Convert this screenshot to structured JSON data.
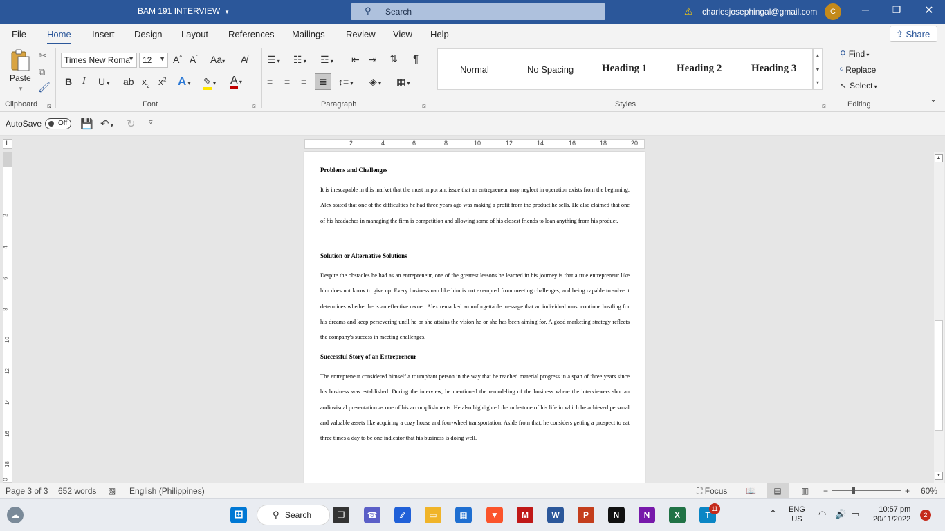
{
  "titlebar": {
    "doc_title": "BAM 191 INTERVIEW",
    "search": "Search",
    "email": "charlesjosephingal@gmail.com",
    "avatar": "C"
  },
  "tabs": [
    "File",
    "Home",
    "Insert",
    "Design",
    "Layout",
    "References",
    "Mailings",
    "Review",
    "View",
    "Help"
  ],
  "share": "Share",
  "ribbon": {
    "paste": "Paste",
    "font_name": "Times New Roma",
    "font_size": "12",
    "groups": {
      "clipboard": "Clipboard",
      "font": "Font",
      "paragraph": "Paragraph",
      "styles": "Styles",
      "editing": "Editing"
    },
    "styles": [
      "Normal",
      "No Spacing",
      "Heading 1",
      "Heading 2",
      "Heading 3"
    ],
    "editing": {
      "find": "Find",
      "replace": "Replace",
      "select": "Select"
    }
  },
  "qat": {
    "autosave": "AutoSave",
    "toggle": "Off"
  },
  "hruler": [
    "2",
    "4",
    "6",
    "8",
    "10",
    "12",
    "14",
    "16",
    "18",
    "20"
  ],
  "vruler": [
    "2",
    "4",
    "6",
    "8",
    "10",
    "12",
    "14",
    "16",
    "18",
    "0"
  ],
  "document": {
    "h1": "Problems and Challenges",
    "p1": "It is inescapable in this market that the most important issue that an entrepreneur may neglect in operation exists from the beginning. Alex stated that one of the difficulties he had three years ago was making a profit from the product he sells. He also claimed that one of his headaches in managing the firm is competition and allowing some of his closest friends to loan anything from his product.",
    "h2": "Solution or Alternative Solutions",
    "p2": "Despite the obstacles he had as an entrepreneur, one of the greatest lessons he learned in his journey is that a true entrepreneur like him does not know to give up. Every businessman like him is not exempted from meeting challenges, and being capable to solve it determines whether he is an effective owner. Alex remarked an unforgettable message that an individual must continue hustling for his dreams and keep persevering until he or she attains the vision he or she has been aiming for. A good marketing strategy reflects the company's success in meeting challenges.",
    "h3": "Successful Story of an Entrepreneur",
    "p3": "The entrepreneur considered himself a triumphant person in the way that he reached material progress in a span of three years since his business was established. During the interview, he mentioned the remodeling of the business where the interviewers shot an audiovisual presentation as one of his accomplishments. He also highlighted the milestone of his life in which he achieved personal and valuable assets like acquiring a cozy house and four-wheel transportation. Aside from that, he considers getting a prospect to eat three times a day to be one indicator that his business is doing well."
  },
  "status": {
    "page": "Page 3 of 3",
    "words": "652 words",
    "language": "English (Philippines)",
    "focus": "Focus",
    "zoom": "60%"
  },
  "taskbar": {
    "search": "Search",
    "teams_badge": "11",
    "lang_top": "ENG",
    "lang_bottom": "US",
    "time": "10:57 pm",
    "date": "20/11/2022",
    "notif": "2"
  }
}
